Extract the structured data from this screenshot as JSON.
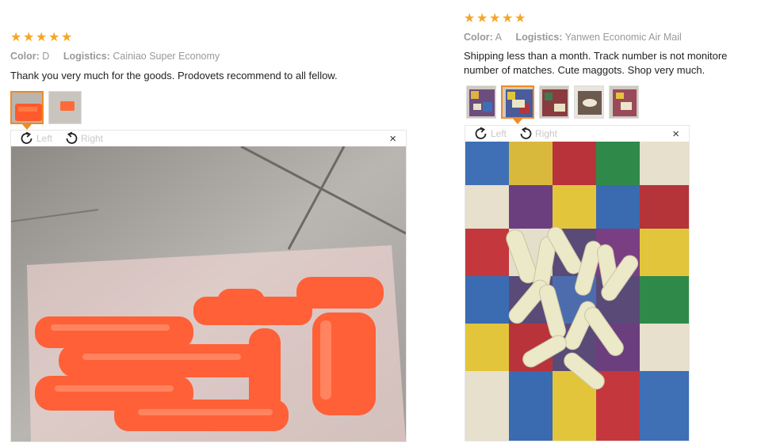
{
  "reviews": [
    {
      "rating": 5,
      "color_label": "Color:",
      "color_value": "D",
      "logistics_label": "Logistics:",
      "logistics_value": "Cainiao Super Economy",
      "text": "Thank you very much for the goods. Prodovets recommend to all fellow.",
      "rotate_left": "Left",
      "rotate_right": "Right",
      "close_glyph": "×"
    },
    {
      "rating": 5,
      "color_label": "Color:",
      "color_value": "A",
      "logistics_label": "Logistics:",
      "logistics_value": "Yanwen Economic Air Mail",
      "text_line1": "Shipping less than a month. Track number is not monitore",
      "text_line2": "number of matches. Cute maggots. Shop very much.",
      "rotate_left": "Left",
      "rotate_right": "Right",
      "close_glyph": "×"
    }
  ],
  "colors": {
    "star": "#f6a623",
    "active_thumb": "#f08a24"
  }
}
